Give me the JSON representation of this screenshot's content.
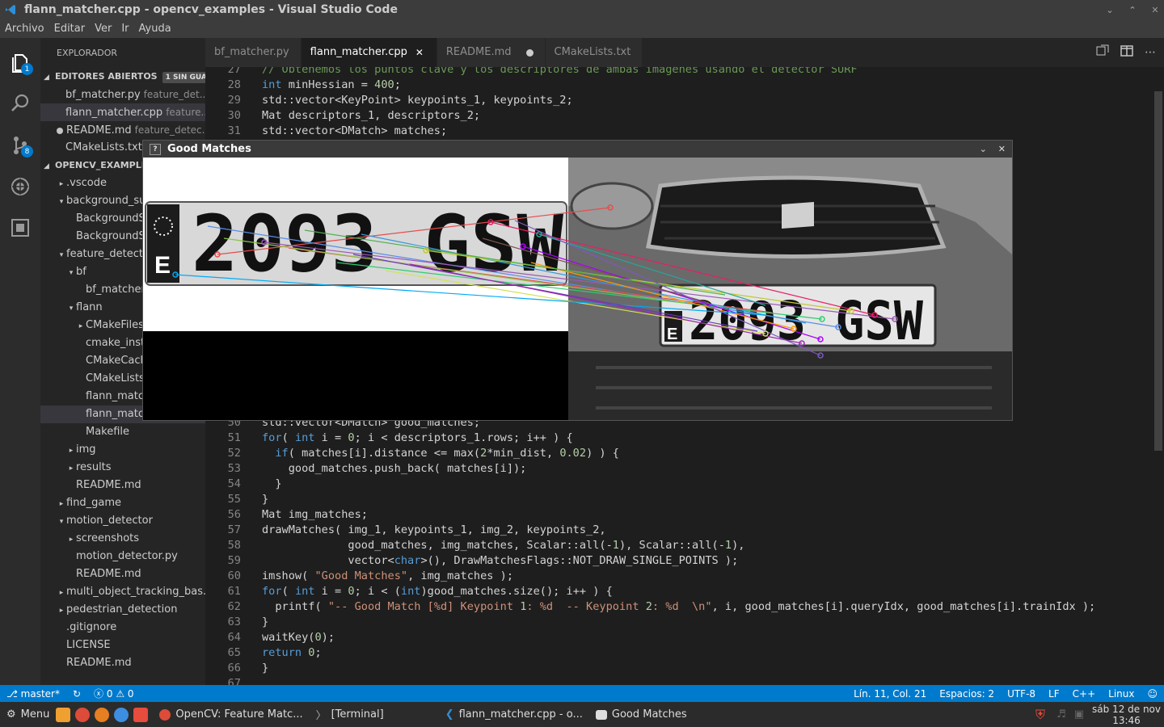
{
  "window_title": "flann_matcher.cpp - opencv_examples - Visual Studio Code",
  "menu": [
    "Archivo",
    "Editar",
    "Ver",
    "Ir",
    "Ayuda"
  ],
  "activity": {
    "explorer_badge": "1",
    "git_badge": "8"
  },
  "sidebar": {
    "header": "EXPLORADOR",
    "open_editors": {
      "title": "EDITORES ABIERTOS",
      "badge": "1 SIN GUAR...",
      "items": [
        {
          "name": "bf_matcher.py",
          "desc": "feature_det..."
        },
        {
          "name": "flann_matcher.cpp",
          "desc": "feature..."
        },
        {
          "name": "README.md",
          "desc": "feature_detec..."
        },
        {
          "name": "CMakeLists.txt",
          "desc": ""
        }
      ]
    },
    "project": {
      "title": "OPENCV_EXAMPLE",
      "items": [
        {
          "label": ".vscode",
          "arrow": "▸"
        },
        {
          "label": "background_sub",
          "arrow": "▾"
        },
        {
          "label": "BackgroundSu",
          "arrow": ""
        },
        {
          "label": "BackgroundSu",
          "arrow": ""
        },
        {
          "label": "feature_detecti",
          "arrow": "▾"
        },
        {
          "label": "bf",
          "arrow": "▾"
        },
        {
          "label": "bf_matcher.",
          "arrow": ""
        },
        {
          "label": "flann",
          "arrow": "▾"
        },
        {
          "label": "CMakeFiles",
          "arrow": "▸"
        },
        {
          "label": "cmake_insta",
          "arrow": ""
        },
        {
          "label": "CMakeCach",
          "arrow": ""
        },
        {
          "label": "CMakeLists.",
          "arrow": ""
        },
        {
          "label": "flann_matcl",
          "arrow": ""
        },
        {
          "label": "flann_matcl",
          "arrow": ""
        },
        {
          "label": "Makefile",
          "arrow": ""
        },
        {
          "label": "img",
          "arrow": "▸"
        },
        {
          "label": "results",
          "arrow": "▸"
        },
        {
          "label": "README.md",
          "arrow": ""
        },
        {
          "label": "find_game",
          "arrow": "▸"
        },
        {
          "label": "motion_detector",
          "arrow": "▾"
        },
        {
          "label": "screenshots",
          "arrow": "▸"
        },
        {
          "label": "motion_detector.py",
          "arrow": ""
        },
        {
          "label": "README.md",
          "arrow": ""
        },
        {
          "label": "multi_object_tracking_bas...",
          "arrow": "▸"
        },
        {
          "label": "pedestrian_detection",
          "arrow": "▸"
        },
        {
          "label": ".gitignore",
          "arrow": ""
        },
        {
          "label": "LICENSE",
          "arrow": ""
        },
        {
          "label": "README.md",
          "arrow": ""
        }
      ]
    }
  },
  "tabs": [
    {
      "label": "bf_matcher.py"
    },
    {
      "label": "flann_matcher.cpp",
      "close": "✕"
    },
    {
      "label": "README.md"
    },
    {
      "label": "CMakeLists.txt"
    }
  ],
  "code_top": [
    {
      "n": "27",
      "t": "// Obtenemos los puntos clave y los descriptores de ambas imágenes usando el detector SURF"
    },
    {
      "n": "28",
      "t": "int minHessian = 400;"
    },
    {
      "n": "29",
      "t": "std::vector<KeyPoint> keypoints_1, keypoints_2;"
    },
    {
      "n": "30",
      "t": "Mat descriptors_1, descriptors_2;"
    },
    {
      "n": "31",
      "t": "std::vector<DMatch> matches;"
    }
  ],
  "code_bottom": [
    {
      "n": "50",
      "t": "std::vector<DMatch> good_matches;"
    },
    {
      "n": "51",
      "t": "for( int i = 0; i < descriptors_1.rows; i++ ) {"
    },
    {
      "n": "52",
      "t": "  if( matches[i].distance <= max(2*min_dist, 0.02) ) {"
    },
    {
      "n": "53",
      "t": "    good_matches.push_back( matches[i]);"
    },
    {
      "n": "54",
      "t": "  }"
    },
    {
      "n": "55",
      "t": "}"
    },
    {
      "n": "56",
      "t": "Mat img_matches;"
    },
    {
      "n": "57",
      "t": "drawMatches( img_1, keypoints_1, img_2, keypoints_2,"
    },
    {
      "n": "58",
      "t": "             good_matches, img_matches, Scalar::all(-1), Scalar::all(-1),"
    },
    {
      "n": "59",
      "t": "             vector<char>(), DrawMatchesFlags::NOT_DRAW_SINGLE_POINTS );"
    },
    {
      "n": "60",
      "t": "imshow( \"Good Matches\", img_matches );"
    },
    {
      "n": "61",
      "t": "for( int i = 0; i < (int)good_matches.size(); i++ ) {"
    },
    {
      "n": "62",
      "t": "  printf( \"-- Good Match [%d] Keypoint 1: %d  -- Keypoint 2: %d  \\n\", i, good_matches[i].queryIdx, good_matches[i].trainIdx );"
    },
    {
      "n": "63",
      "t": "}"
    },
    {
      "n": "64",
      "t": "waitKey(0);"
    },
    {
      "n": "65",
      "t": "return 0;"
    },
    {
      "n": "66",
      "t": "}"
    },
    {
      "n": "67",
      "t": ""
    }
  ],
  "good_matches_window": {
    "title": "Good Matches",
    "plate_text": "2093 GSW",
    "plate_country": "E"
  },
  "statusbar": {
    "branch": "master*",
    "errors": "0",
    "warnings": "0",
    "position": "Lín. 11, Col. 21",
    "spaces": "Espacios: 2",
    "encoding": "UTF-8",
    "eol": "LF",
    "language": "C++",
    "os": "Linux"
  },
  "taskbar": {
    "menu": "Menu",
    "items": [
      "OpenCV: Feature Matc...",
      "[Terminal]",
      "flann_matcher.cpp - o...",
      "Good Matches"
    ],
    "date": "sáb 12 de nov",
    "time": "13:46"
  }
}
